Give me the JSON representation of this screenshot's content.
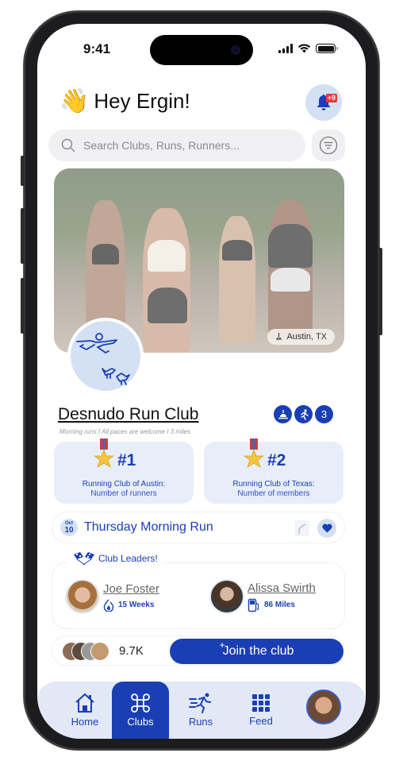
{
  "status_bar": {
    "time": "9:41"
  },
  "header": {
    "wave_emoji": "👋",
    "greeting": "Hey Ergin!",
    "notifications_badge": "+9"
  },
  "search": {
    "placeholder": "Search Clubs, Runs, Runners..."
  },
  "hero": {
    "location": "Austin, TX"
  },
  "club": {
    "name": "Desnudo Run Club",
    "subtitle": "Morning runs  I  All paces are welcome  I  3 miles",
    "tags": [
      {
        "icon": "sunrise-icon"
      },
      {
        "icon": "runner-icon"
      },
      {
        "label": "3"
      }
    ]
  },
  "rankings": [
    {
      "rank": "#1",
      "title": "Running Club of Austin:",
      "subtitle": "Number of runners"
    },
    {
      "rank": "#2",
      "title": "Running Club of Texas:",
      "subtitle": "Number of members"
    }
  ],
  "event": {
    "month": "Oct",
    "day": "10",
    "name": "Thursday Morning Run"
  },
  "leaders": {
    "title": "Club Leaders!",
    "items": [
      {
        "name": "Joe Foster",
        "stat": "15 Weeks",
        "stat_icon": "streak-icon"
      },
      {
        "name": "Alissa Swirth",
        "stat": "86 Miles",
        "stat_icon": "fuel-icon"
      }
    ]
  },
  "members": {
    "count": "9.7K",
    "join_plus": "+",
    "join_label": "Join the club"
  },
  "tabbar": {
    "items": [
      {
        "label": "Home",
        "icon": "home-icon"
      },
      {
        "label": "Clubs",
        "icon": "command-icon",
        "active": true
      },
      {
        "label": "Runs",
        "icon": "runner-icon"
      },
      {
        "label": "Feed",
        "icon": "grid-icon"
      }
    ]
  },
  "colors": {
    "accent": "#1a3fb5",
    "accent_light": "#d4e0f4",
    "card_bg": "#e8eef9",
    "badge_red": "#e53935"
  }
}
